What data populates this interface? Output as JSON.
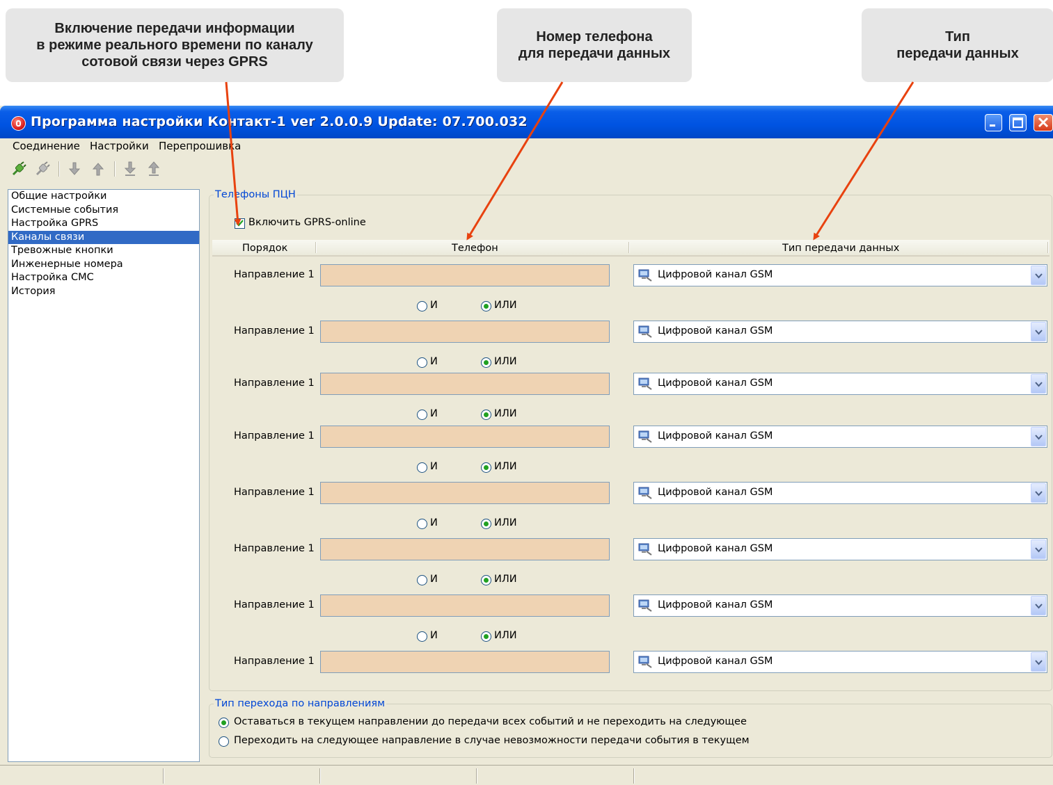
{
  "callouts": [
    "Включение передачи информации\nв режиме реального времени по каналу\nсотовой связи через GPRS",
    "Номер телефона\nдля передачи данных",
    "Тип\nпередачи данных"
  ],
  "window": {
    "title": "Программа настройки Контакт-1 ver 2.0.0.9 Update: 07.700.032"
  },
  "menu": [
    "Соединение",
    "Настройки",
    "Перепрошивка"
  ],
  "toolbar": {
    "icons": [
      "connect-icon",
      "disconnect-icon",
      "read-icon",
      "write-icon",
      "read-file-icon",
      "write-file-icon"
    ]
  },
  "tree": {
    "items": [
      "Общие настройки",
      "Системные события",
      "Настройка GPRS",
      "Каналы связи",
      "Тревожные кнопки",
      "Инженерные номера",
      "Настройка СМС",
      "История"
    ],
    "selected": "Каналы связи"
  },
  "phones_group": {
    "legend": "Телефоны ПЦН",
    "gprs_checkbox_label": "Включить GPRS-online",
    "gprs_checked": true,
    "headers": [
      "Порядок",
      "Телефон",
      "Тип передачи данных"
    ],
    "rows": [
      {
        "label": "Направление 1",
        "phone": "",
        "type": "Цифровой канал GSM"
      },
      {
        "label": "Направление 1",
        "phone": "",
        "type": "Цифровой канал GSM"
      },
      {
        "label": "Направление 1",
        "phone": "",
        "type": "Цифровой канал GSM"
      },
      {
        "label": "Направление 1",
        "phone": "",
        "type": "Цифровой канал GSM"
      },
      {
        "label": "Направление 1",
        "phone": "",
        "type": "Цифровой канал GSM"
      },
      {
        "label": "Направление 1",
        "phone": "",
        "type": "Цифровой канал GSM"
      },
      {
        "label": "Направление 1",
        "phone": "",
        "type": "Цифровой канал GSM"
      },
      {
        "label": "Направление 1",
        "phone": "",
        "type": "Цифровой канал GSM"
      }
    ],
    "logic": {
      "and_label": "И",
      "or_label": "ИЛИ",
      "selected": "ИЛИ"
    }
  },
  "transition_group": {
    "legend": "Тип перехода по направлениям",
    "options": [
      "Оставаться в текущем направлении до передачи всех событий и не переходить на следующее",
      "Переходить на следующее направление в случае невозможности передачи события в текущем"
    ],
    "selected_index": 0
  },
  "colors": {
    "arrow": "#e8420f",
    "phone_field": "#efd3b3",
    "selection": "#316ac5",
    "legend": "#0046d5"
  }
}
